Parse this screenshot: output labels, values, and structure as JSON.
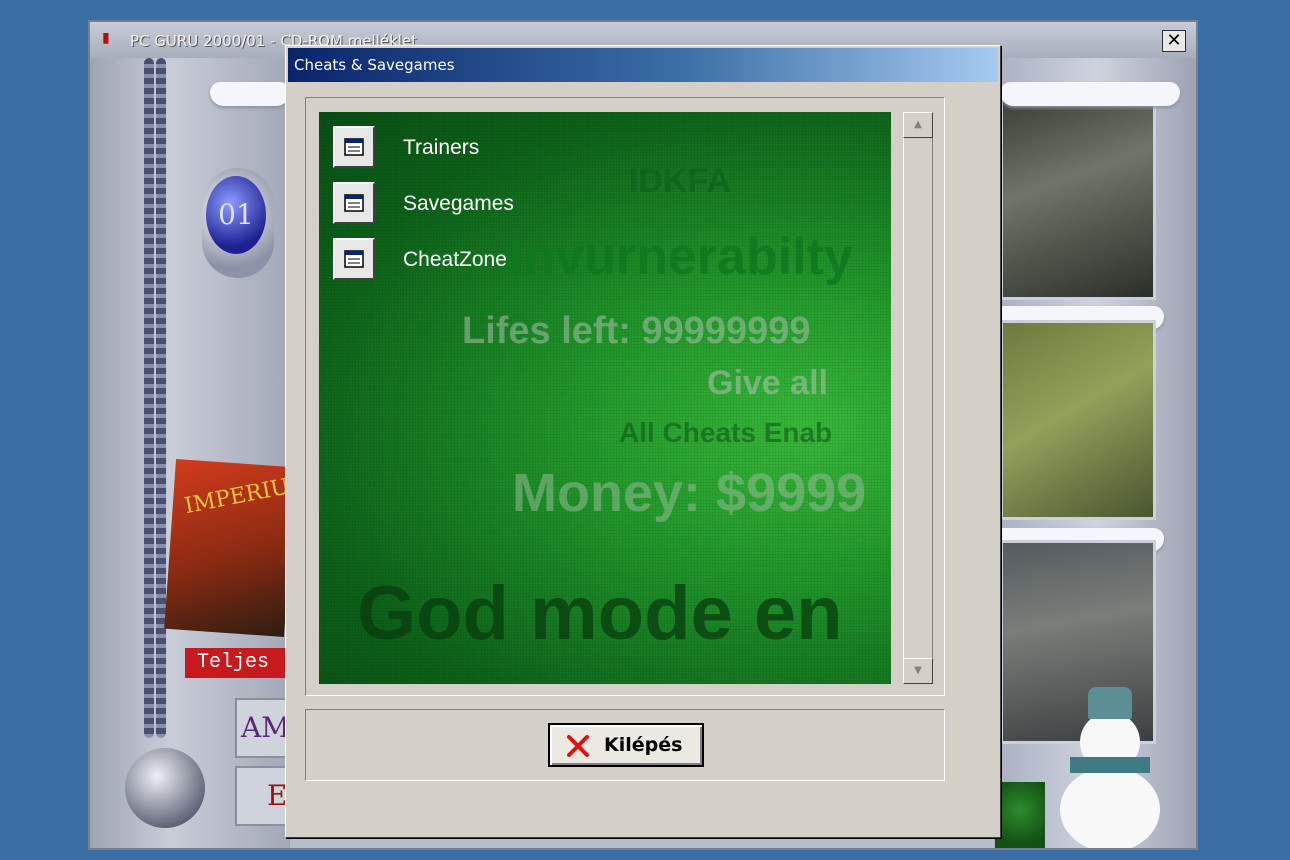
{
  "background_window": {
    "title": "PC GURU 2000/01 - CD-ROM melléklet",
    "close_glyph": "✕",
    "robot_badge": "01",
    "game_box_text": "IMPERIUM",
    "tag_text": "Teljes",
    "plate_1": "AMI",
    "plate_2": "E"
  },
  "dialog": {
    "title": "Cheats & Savegames",
    "menu_items": [
      {
        "label": "Trainers",
        "icon": "window-icon"
      },
      {
        "label": "Savegames",
        "icon": "window-icon"
      },
      {
        "label": "CheatZone",
        "icon": "window-icon"
      }
    ],
    "decorative_text": {
      "idkfa": "IDKFA",
      "invulnerability": "Invurnerabilty",
      "lifes": "Lifes left: 99999999",
      "give_all": "Give all",
      "all_cheats": "All Cheats Enab",
      "money": "Money: $9999",
      "god_mode": "God mode en"
    },
    "scroll_up_glyph": "▲",
    "scroll_down_glyph": "▼",
    "exit_button": {
      "label": "Kilépés",
      "icon": "red-x-icon"
    }
  },
  "colors": {
    "desktop": "#3a6ea5",
    "dialog_face": "#d4d0c8",
    "title_gradient_start": "#0a246a",
    "title_gradient_end": "#a6caf0",
    "panel_green": "#20952a",
    "exit_x": "#e01010"
  }
}
